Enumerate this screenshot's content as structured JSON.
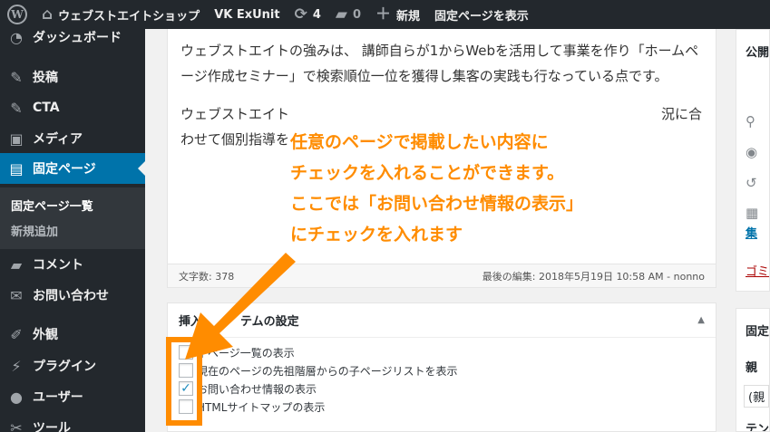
{
  "adminbar": {
    "site_name": "ウェブストエイトショップ",
    "vk_exunit": "VK ExUnit",
    "updates_count": "4",
    "comments_count": "0",
    "new_label": "新規",
    "view_page": "固定ページを表示"
  },
  "sidebar": {
    "items": [
      {
        "label": "ダッシュボード",
        "icon": "dashboard-icon"
      },
      {
        "label": "投稿",
        "icon": "pin-icon"
      },
      {
        "label": "CTA",
        "icon": "pin-icon"
      },
      {
        "label": "メディア",
        "icon": "media-icon"
      },
      {
        "label": "固定ページ",
        "icon": "page-icon"
      },
      {
        "label": "コメント",
        "icon": "comment-icon"
      },
      {
        "label": "お問い合わせ",
        "icon": "mail-icon"
      },
      {
        "label": "外観",
        "icon": "brush-icon"
      },
      {
        "label": "プラグイン",
        "icon": "plugin-icon"
      },
      {
        "label": "ユーザー",
        "icon": "user-icon"
      },
      {
        "label": "ツール",
        "icon": "tool-icon"
      }
    ],
    "submenu": [
      "固定ページ一覧",
      "新規追加"
    ]
  },
  "editor": {
    "paragraph1": "ウェブストエイトの強みは、 講師自らが1からWebを活用して事業を作り「ホームページ作成セミナー」で検索順位一位を獲得し集客の実践も行なっている点です。",
    "paragraph2": "ウェブストエイト",
    "paragraph2_right": "況に合",
    "paragraph2_line2": "わせて個別指導を",
    "word_count": "文字数: 378",
    "last_edit": "最後の編集: 2018年5月19日 10:58 AM - nonno"
  },
  "insertbox": {
    "title_visible_left": "挿入",
    "title_visible_right": "テムの設定",
    "items": [
      {
        "label": "子ページ一覧の表示",
        "checked": false
      },
      {
        "label": "現在のページの先祖階層からの子ページリストを表示",
        "checked": false
      },
      {
        "label": "お問い合わせ情報の表示",
        "checked": true
      },
      {
        "label": "HTMLサイトマップの表示",
        "checked": false
      }
    ]
  },
  "right_column": {
    "publish_title": "公開",
    "link_text": "集",
    "trash_text": "ゴミ",
    "attr_title": "固定",
    "parent_label": "親",
    "parent_select": "(親",
    "template_label": "テン"
  },
  "annotation": {
    "lines": [
      "任意のページで掲載したい内容に",
      "チェックを入れることができます。",
      "ここでは「お問い合わせ情報の表示」",
      "にチェックを入れます"
    ]
  },
  "colors": {
    "annotation": "#ff8c00",
    "admin_dark": "#23282d",
    "current_menu": "#0073aa",
    "check": "#1e8cbe"
  }
}
